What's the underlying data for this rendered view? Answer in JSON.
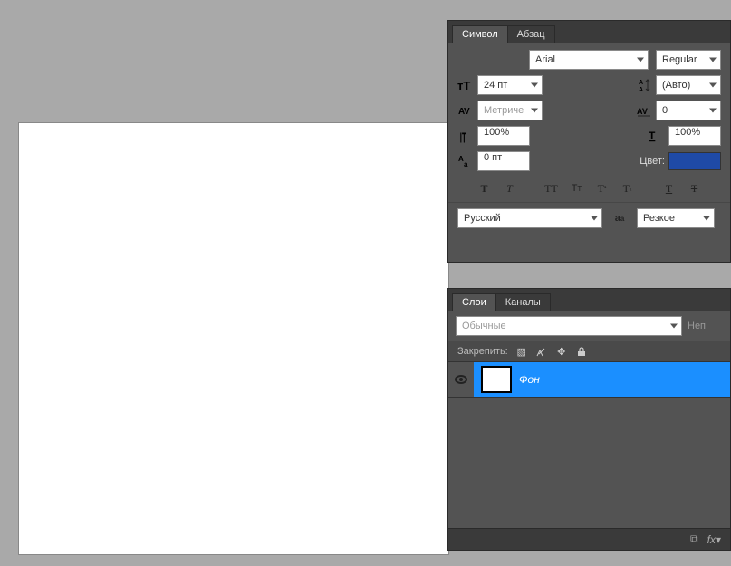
{
  "character_panel": {
    "tabs": {
      "symbol": "Символ",
      "paragraph": "Абзац"
    },
    "font_family": "Arial",
    "font_style": "Regular",
    "font_size": "24 пт",
    "leading": "(Авто)",
    "kerning": "Метриче",
    "tracking": "0",
    "vscale": "100%",
    "hscale": "100%",
    "baseline": "0 пт",
    "color_label": "Цвет:",
    "color_value": "#1f4aa6",
    "language": "Русский",
    "antialias": "Резкое"
  },
  "layers_panel": {
    "tabs": {
      "layers": "Слои",
      "channels": "Каналы"
    },
    "blend_mode": "Обычные",
    "opacity_label": "Неп",
    "lock_label": "Закрепить:",
    "layer_name": "Фон"
  }
}
